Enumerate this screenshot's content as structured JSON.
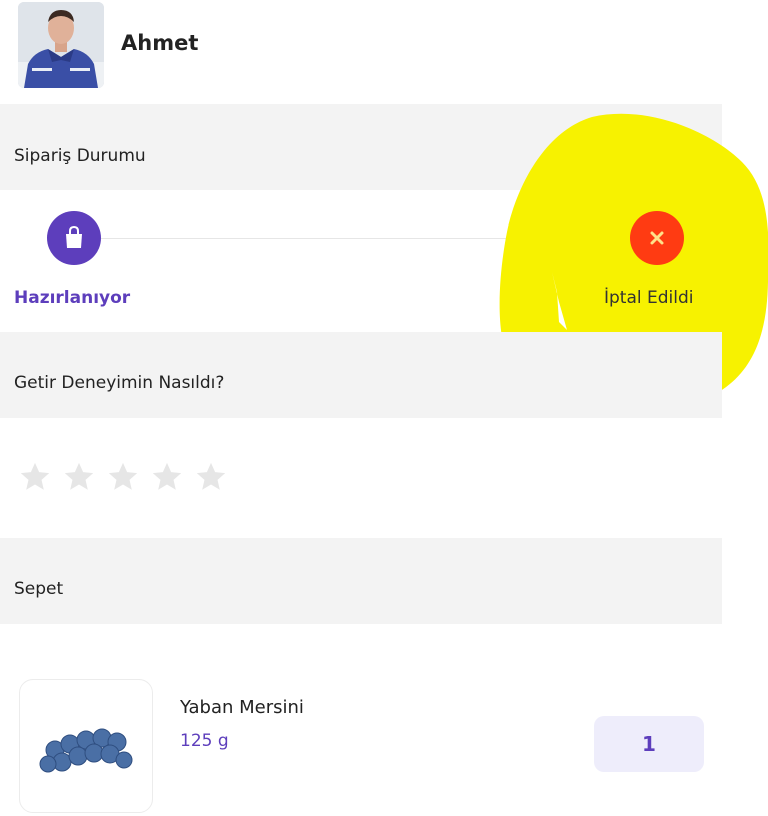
{
  "user": {
    "name": "Ahmet"
  },
  "order_status": {
    "section_title": "Sipariş Durumu",
    "steps": [
      {
        "label": "Hazırlanıyor",
        "icon": "shopping-bag-icon",
        "color": "#5d3ebc",
        "active": true
      },
      {
        "label": "İptal Edildi",
        "icon": "close-icon",
        "color": "#ff3b12",
        "active": true
      }
    ]
  },
  "rating": {
    "section_title": "Getir Deneyimin Nasıldı?",
    "max_stars": 5,
    "value": 0
  },
  "basket": {
    "section_title": "Sepet",
    "items": [
      {
        "name": "Yaban Mersini",
        "weight": "125 g",
        "quantity": "1"
      }
    ]
  },
  "colors": {
    "brand": "#5d3ebc",
    "danger": "#ff3b12",
    "highlight": "#f7f200",
    "bar_bg": "#f3f3f3"
  }
}
